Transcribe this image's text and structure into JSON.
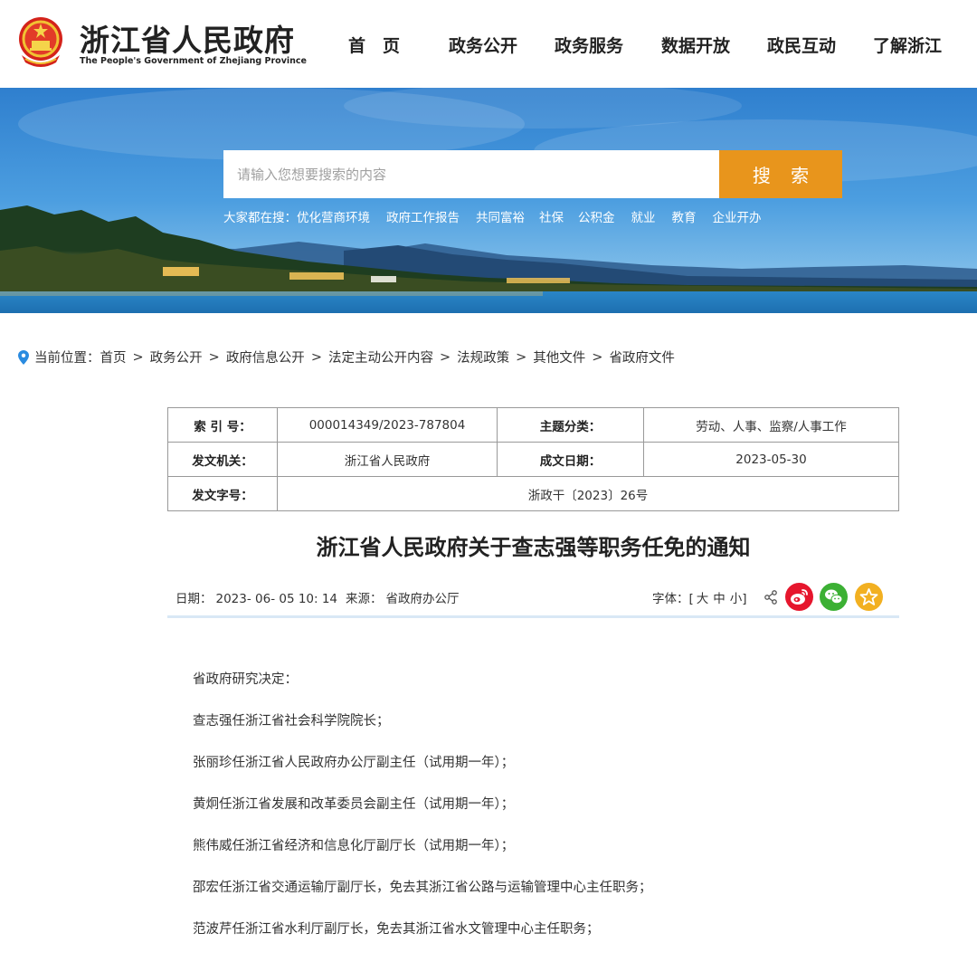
{
  "header": {
    "site_name": "浙江省人民政府",
    "site_name_en": "The People's Government of Zhejiang Province",
    "nav": [
      "首　页",
      "政务公开",
      "政务服务",
      "数据开放",
      "政民互动",
      "了解浙江"
    ]
  },
  "search": {
    "placeholder": "请输入您想要搜索的内容",
    "button_label": "搜 索",
    "hot_label": "大家都在搜：",
    "hot_items": [
      "优化营商环境",
      "政府工作报告",
      "共同富裕",
      "社保",
      "公积金",
      "就业",
      "教育",
      "企业开办"
    ]
  },
  "breadcrumb": {
    "prefix": "当前位置：",
    "items": [
      "首页",
      "政务公开",
      "政府信息公开",
      "法定主动公开内容",
      "法规政策",
      "其他文件",
      "省政府文件"
    ],
    "separator": ">"
  },
  "info_table": {
    "index_label": "索 引 号：",
    "index_value": "000014349/2023-787804",
    "topic_label": "主题分类：",
    "topic_value": "劳动、人事、监察/人事工作",
    "issuer_label": "发文机关：",
    "issuer_value": "浙江省人民政府",
    "date_label": "成文日期：",
    "date_value": "2023-05-30",
    "docno_label": "发文字号：",
    "docno_value": "浙政干〔2023〕26号"
  },
  "article": {
    "title": "浙江省人民政府关于查志强等职务任免的通知",
    "date_label": "日期：",
    "date_value": "2023- 06- 05 10: 14",
    "source_label": "来源：",
    "source_value": "省政府办公厅",
    "font_label": "字体：[",
    "font_large": "大",
    "font_medium": "中",
    "font_small": "小",
    "font_close": "]",
    "paragraphs": [
      "省政府研究决定：",
      "查志强任浙江省社会科学院院长；",
      "张丽珍任浙江省人民政府办公厅副主任（试用期一年）；",
      "黄炯任浙江省发展和改革委员会副主任（试用期一年）；",
      "熊伟威任浙江省经济和信息化厅副厅长（试用期一年）；",
      "邵宏任浙江省交通运输厅副厅长，免去其浙江省公路与运输管理中心主任职务；",
      "范波芹任浙江省水利厅副厅长，免去其浙江省水文管理中心主任职务；"
    ]
  },
  "colors": {
    "search_button": "#e8951c",
    "weibo": "#e6162d",
    "wechat": "#3cb034",
    "favorite": "#f2b021",
    "divider": "#d9e8f5"
  },
  "icons": [
    "national-emblem-icon",
    "location-pin-icon",
    "share-icon",
    "weibo-icon",
    "wechat-icon",
    "favorite-icon"
  ]
}
